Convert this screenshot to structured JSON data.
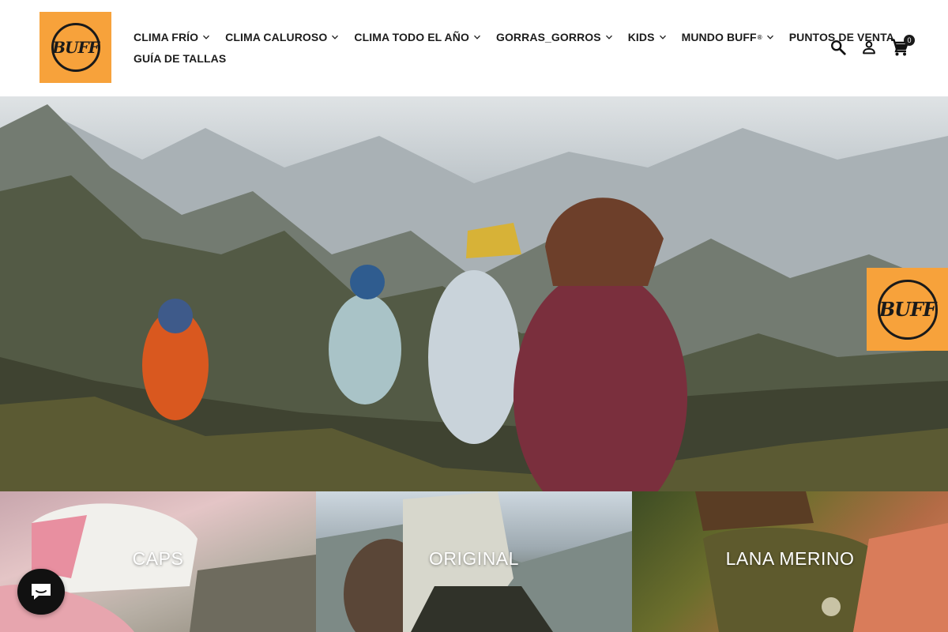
{
  "brand": {
    "logo_text": "BUFF",
    "accent": "#f7a23b"
  },
  "nav": {
    "row1": [
      {
        "label": "CLIMA FRÍO",
        "has_dropdown": true
      },
      {
        "label": "CLIMA CALUROSO",
        "has_dropdown": true
      },
      {
        "label": "CLIMA TODO EL AÑO",
        "has_dropdown": true
      },
      {
        "label": "GORRAS_GORROS",
        "has_dropdown": true
      },
      {
        "label": "KIDS",
        "has_dropdown": true
      },
      {
        "label": "MUNDO BUFF",
        "sup": "®",
        "has_dropdown": true
      },
      {
        "label": "PUNTOS DE VENTA",
        "has_dropdown": false
      }
    ],
    "row2": [
      {
        "label": "GUÍA DE TALLAS",
        "has_dropdown": false
      }
    ]
  },
  "header_icons": {
    "search": "search-icon",
    "account": "person-icon",
    "cart": "cart-icon",
    "cart_count": "0"
  },
  "hero": {
    "badge_text": "BUFF"
  },
  "categories": [
    {
      "label": "CAPS"
    },
    {
      "label": "ORIGINAL"
    },
    {
      "label": "LANA MERINO"
    }
  ],
  "chat": {
    "icon": "chat-icon"
  }
}
